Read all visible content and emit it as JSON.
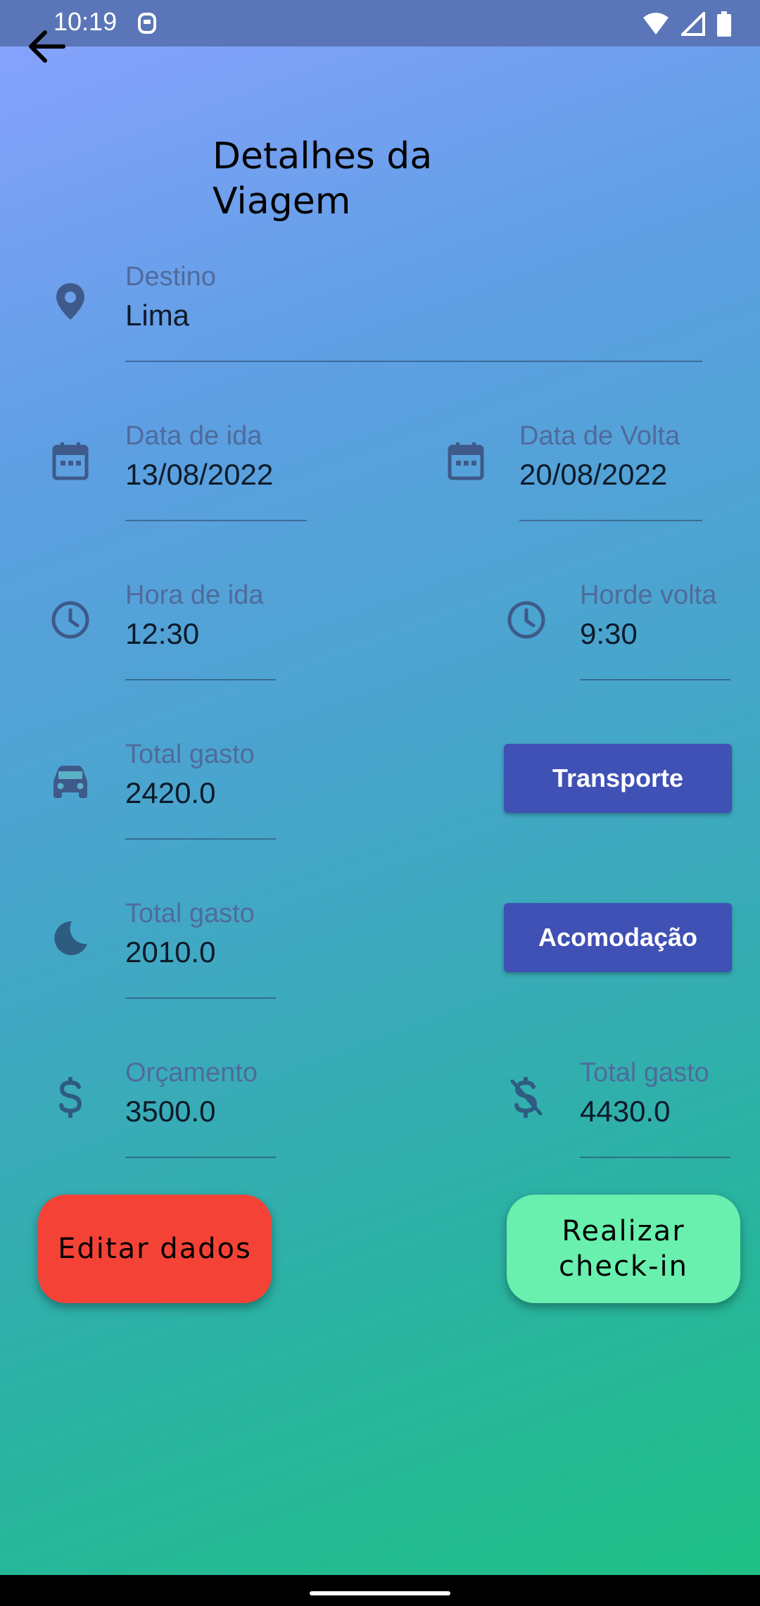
{
  "status_bar": {
    "time": "10:19"
  },
  "header": {
    "title": "Detalhes da Viagem"
  },
  "fields": {
    "destino": {
      "label": "Destino",
      "value": "Lima"
    },
    "data_ida": {
      "label": "Data de ida",
      "value": "13/08/2022"
    },
    "data_volta": {
      "label": "Data de Volta",
      "value": "20/08/2022"
    },
    "hora_ida": {
      "label": "Hora de ida",
      "value": "12:30"
    },
    "hora_volta": {
      "label": "Horde volta",
      "value": "9:30"
    },
    "transporte_total": {
      "label": "Total gasto",
      "value": "2420.0"
    },
    "acomodacao_total": {
      "label": "Total gasto",
      "value": "2010.0"
    },
    "orcamento": {
      "label": "Orçamento",
      "value": "3500.0"
    },
    "total_gasto": {
      "label": "Total gasto",
      "value": "4430.0"
    }
  },
  "buttons": {
    "transporte": "Transporte",
    "acomodacao": "Acomodação",
    "editar": "Editar dados",
    "checkin": "Realizar check-in"
  },
  "colors": {
    "button_blue": "#3f51b5",
    "edit_red": "#f44336",
    "checkin_green": "#69f0ae",
    "icon": "#3e5a8a"
  }
}
